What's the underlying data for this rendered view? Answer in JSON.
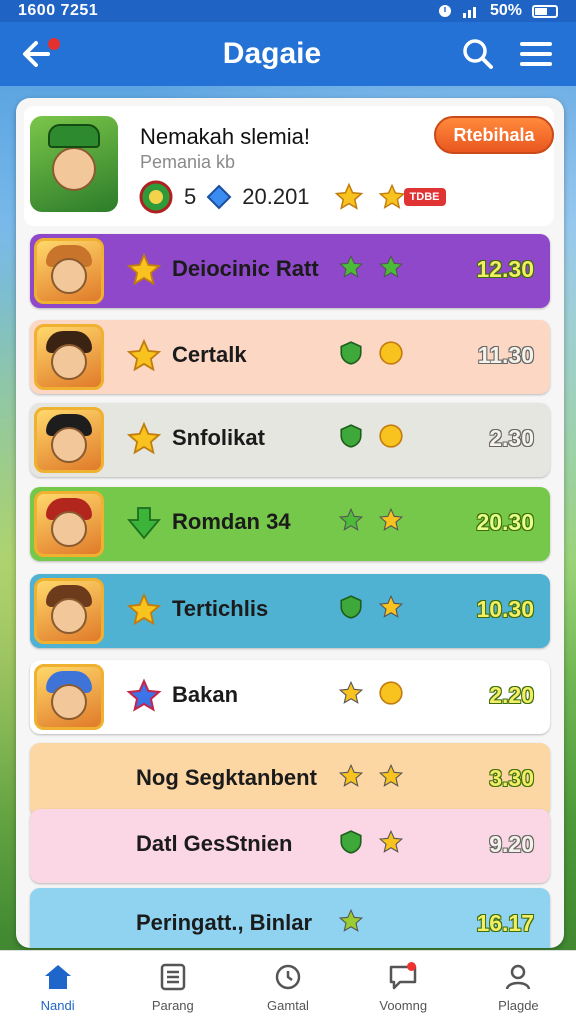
{
  "status": {
    "time": "1600 7251",
    "battery": "50%"
  },
  "appbar": {
    "title": "Dagaie"
  },
  "header": {
    "title": "Nemakah slemia!",
    "subtitle": "Pemania kb",
    "stat_count": "5",
    "stat_score": "20.201",
    "badge": "TDBE",
    "button_label": "Rtebihala"
  },
  "rows": [
    {
      "name": "Deiocinic Ratt",
      "value": "12.30",
      "bg": "#8e48c9"
    },
    {
      "name": "Certalk",
      "value": "11.30",
      "bg": "#fbd7c4"
    },
    {
      "name": "Snfolikat",
      "value": "2.30",
      "bg": "#e6e6e0"
    },
    {
      "name": "Romdan 34",
      "value": "20.30",
      "bg": "#76c84a"
    },
    {
      "name": "Tertichlis",
      "value": "10.30",
      "bg": "#4fb2d3"
    },
    {
      "name": "Bakan",
      "value": "2.20",
      "bg": "#ffffff"
    },
    {
      "name": "Nog Segktanbent",
      "value": "3.30",
      "bg": "#fcd7a4"
    },
    {
      "name": "Datl GesStnien",
      "value": "9.20",
      "bg": "#fbd6e4"
    },
    {
      "name": "Peringatt., Binlar",
      "value": "16.17",
      "bg": "#8fd3f1"
    }
  ],
  "nav": [
    {
      "label": "Nandi",
      "icon": "home-icon"
    },
    {
      "label": "Parang",
      "icon": "list-icon"
    },
    {
      "label": "Gamtal",
      "icon": "clock-icon"
    },
    {
      "label": "Voomng",
      "icon": "chat-icon"
    },
    {
      "label": "Plagde",
      "icon": "profile-icon"
    }
  ],
  "colors": {
    "appbar": "#2472d6",
    "accent": "#1e66c9",
    "button": "#e9571f"
  }
}
